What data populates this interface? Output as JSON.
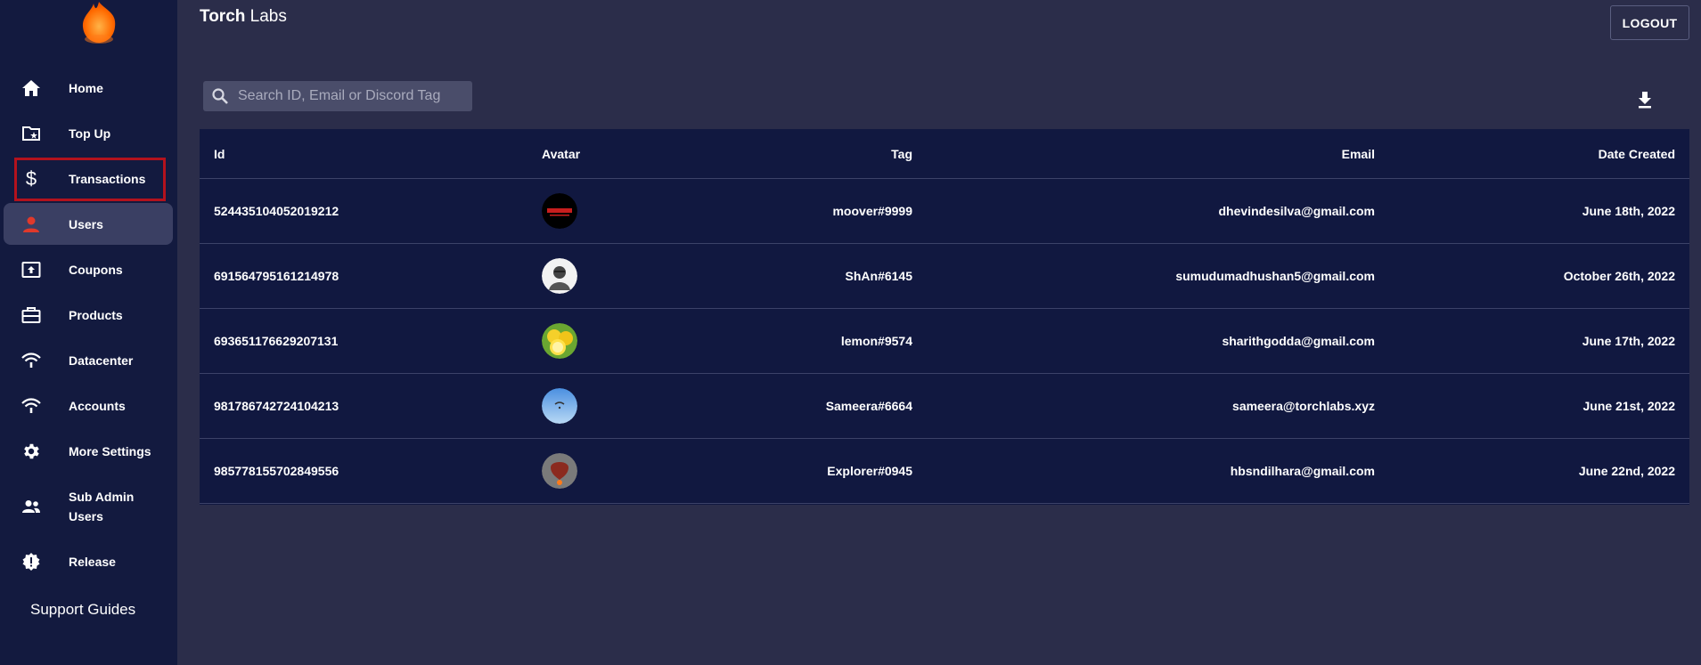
{
  "app": {
    "brand_bold": "Torch",
    "brand_rest": " Labs",
    "logout_label": "LOGOUT"
  },
  "sidebar": {
    "items": [
      {
        "label": "Home",
        "icon": "home-icon"
      },
      {
        "label": "Top Up",
        "icon": "folder-star-icon"
      },
      {
        "label": "Transactions",
        "icon": "dollar-icon"
      },
      {
        "label": "Users",
        "icon": "person-icon"
      },
      {
        "label": "Coupons",
        "icon": "upload-box-icon"
      },
      {
        "label": "Products",
        "icon": "briefcase-icon"
      },
      {
        "label": "Datacenter",
        "icon": "wifi-icon"
      },
      {
        "label": "Accounts",
        "icon": "wifi-icon"
      },
      {
        "label": "More Settings",
        "icon": "gear-icon"
      },
      {
        "label": "Sub Admin Users",
        "icon": "group-icon"
      },
      {
        "label": "Release",
        "icon": "alert-badge-icon"
      }
    ],
    "active": "Users",
    "highlighted": "Transactions",
    "support_label": "Support Guides"
  },
  "search": {
    "placeholder": "Search ID, Email or Discord Tag",
    "value": ""
  },
  "table": {
    "headers": {
      "id": "Id",
      "avatar": "Avatar",
      "tag": "Tag",
      "email": "Email",
      "date": "Date Created"
    },
    "rows": [
      {
        "id": "524435104052019212",
        "tag": "moover#9999",
        "email": "dhevindesilva@gmail.com",
        "date": "June 18th, 2022",
        "avatar": "moover-logo"
      },
      {
        "id": "691564795161214978",
        "tag": "ShAn#6145",
        "email": "sumudumadhushan5@gmail.com",
        "date": "October 26th, 2022",
        "avatar": "person-portrait"
      },
      {
        "id": "693651176629207131",
        "tag": "lemon#9574",
        "email": "sharithgodda@gmail.com",
        "date": "June 17th, 2022",
        "avatar": "lemons"
      },
      {
        "id": "981786742724104213",
        "tag": "Sameera#6664",
        "email": "sameera@torchlabs.xyz",
        "date": "June 21st, 2022",
        "avatar": "sky-paraglider"
      },
      {
        "id": "985778155702849556",
        "tag": "Explorer#0945",
        "email": "hbsndilhara@gmail.com",
        "date": "June 22nd, 2022",
        "avatar": "hot-air-balloon"
      }
    ]
  },
  "colors": {
    "page_bg": "#2b2d4a",
    "sidebar_bg": "#131a3f",
    "table_bg": "#111840",
    "active_item_bg": "#3a3f63",
    "accent_red": "#e0392b",
    "highlight_border": "#b3121d"
  }
}
